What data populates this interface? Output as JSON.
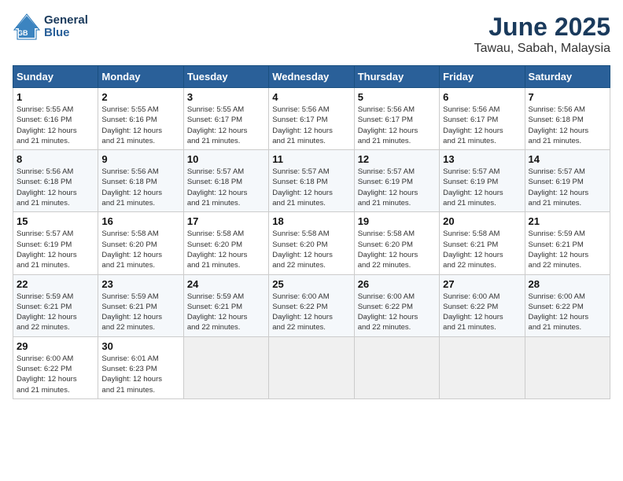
{
  "header": {
    "logo_line1": "General",
    "logo_line2": "Blue",
    "month": "June 2025",
    "location": "Tawau, Sabah, Malaysia"
  },
  "weekdays": [
    "Sunday",
    "Monday",
    "Tuesday",
    "Wednesday",
    "Thursday",
    "Friday",
    "Saturday"
  ],
  "weeks": [
    [
      {
        "day": "1",
        "text": "Sunrise: 5:55 AM\nSunset: 6:16 PM\nDaylight: 12 hours\nand 21 minutes."
      },
      {
        "day": "2",
        "text": "Sunrise: 5:55 AM\nSunset: 6:16 PM\nDaylight: 12 hours\nand 21 minutes."
      },
      {
        "day": "3",
        "text": "Sunrise: 5:55 AM\nSunset: 6:17 PM\nDaylight: 12 hours\nand 21 minutes."
      },
      {
        "day": "4",
        "text": "Sunrise: 5:56 AM\nSunset: 6:17 PM\nDaylight: 12 hours\nand 21 minutes."
      },
      {
        "day": "5",
        "text": "Sunrise: 5:56 AM\nSunset: 6:17 PM\nDaylight: 12 hours\nand 21 minutes."
      },
      {
        "day": "6",
        "text": "Sunrise: 5:56 AM\nSunset: 6:17 PM\nDaylight: 12 hours\nand 21 minutes."
      },
      {
        "day": "7",
        "text": "Sunrise: 5:56 AM\nSunset: 6:18 PM\nDaylight: 12 hours\nand 21 minutes."
      }
    ],
    [
      {
        "day": "8",
        "text": "Sunrise: 5:56 AM\nSunset: 6:18 PM\nDaylight: 12 hours\nand 21 minutes."
      },
      {
        "day": "9",
        "text": "Sunrise: 5:56 AM\nSunset: 6:18 PM\nDaylight: 12 hours\nand 21 minutes."
      },
      {
        "day": "10",
        "text": "Sunrise: 5:57 AM\nSunset: 6:18 PM\nDaylight: 12 hours\nand 21 minutes."
      },
      {
        "day": "11",
        "text": "Sunrise: 5:57 AM\nSunset: 6:18 PM\nDaylight: 12 hours\nand 21 minutes."
      },
      {
        "day": "12",
        "text": "Sunrise: 5:57 AM\nSunset: 6:19 PM\nDaylight: 12 hours\nand 21 minutes."
      },
      {
        "day": "13",
        "text": "Sunrise: 5:57 AM\nSunset: 6:19 PM\nDaylight: 12 hours\nand 21 minutes."
      },
      {
        "day": "14",
        "text": "Sunrise: 5:57 AM\nSunset: 6:19 PM\nDaylight: 12 hours\nand 21 minutes."
      }
    ],
    [
      {
        "day": "15",
        "text": "Sunrise: 5:57 AM\nSunset: 6:19 PM\nDaylight: 12 hours\nand 21 minutes."
      },
      {
        "day": "16",
        "text": "Sunrise: 5:58 AM\nSunset: 6:20 PM\nDaylight: 12 hours\nand 21 minutes."
      },
      {
        "day": "17",
        "text": "Sunrise: 5:58 AM\nSunset: 6:20 PM\nDaylight: 12 hours\nand 21 minutes."
      },
      {
        "day": "18",
        "text": "Sunrise: 5:58 AM\nSunset: 6:20 PM\nDaylight: 12 hours\nand 22 minutes."
      },
      {
        "day": "19",
        "text": "Sunrise: 5:58 AM\nSunset: 6:20 PM\nDaylight: 12 hours\nand 22 minutes."
      },
      {
        "day": "20",
        "text": "Sunrise: 5:58 AM\nSunset: 6:21 PM\nDaylight: 12 hours\nand 22 minutes."
      },
      {
        "day": "21",
        "text": "Sunrise: 5:59 AM\nSunset: 6:21 PM\nDaylight: 12 hours\nand 22 minutes."
      }
    ],
    [
      {
        "day": "22",
        "text": "Sunrise: 5:59 AM\nSunset: 6:21 PM\nDaylight: 12 hours\nand 22 minutes."
      },
      {
        "day": "23",
        "text": "Sunrise: 5:59 AM\nSunset: 6:21 PM\nDaylight: 12 hours\nand 22 minutes."
      },
      {
        "day": "24",
        "text": "Sunrise: 5:59 AM\nSunset: 6:21 PM\nDaylight: 12 hours\nand 22 minutes."
      },
      {
        "day": "25",
        "text": "Sunrise: 6:00 AM\nSunset: 6:22 PM\nDaylight: 12 hours\nand 22 minutes."
      },
      {
        "day": "26",
        "text": "Sunrise: 6:00 AM\nSunset: 6:22 PM\nDaylight: 12 hours\nand 22 minutes."
      },
      {
        "day": "27",
        "text": "Sunrise: 6:00 AM\nSunset: 6:22 PM\nDaylight: 12 hours\nand 21 minutes."
      },
      {
        "day": "28",
        "text": "Sunrise: 6:00 AM\nSunset: 6:22 PM\nDaylight: 12 hours\nand 21 minutes."
      }
    ],
    [
      {
        "day": "29",
        "text": "Sunrise: 6:00 AM\nSunset: 6:22 PM\nDaylight: 12 hours\nand 21 minutes."
      },
      {
        "day": "30",
        "text": "Sunrise: 6:01 AM\nSunset: 6:23 PM\nDaylight: 12 hours\nand 21 minutes."
      },
      {
        "day": "",
        "text": ""
      },
      {
        "day": "",
        "text": ""
      },
      {
        "day": "",
        "text": ""
      },
      {
        "day": "",
        "text": ""
      },
      {
        "day": "",
        "text": ""
      }
    ]
  ]
}
